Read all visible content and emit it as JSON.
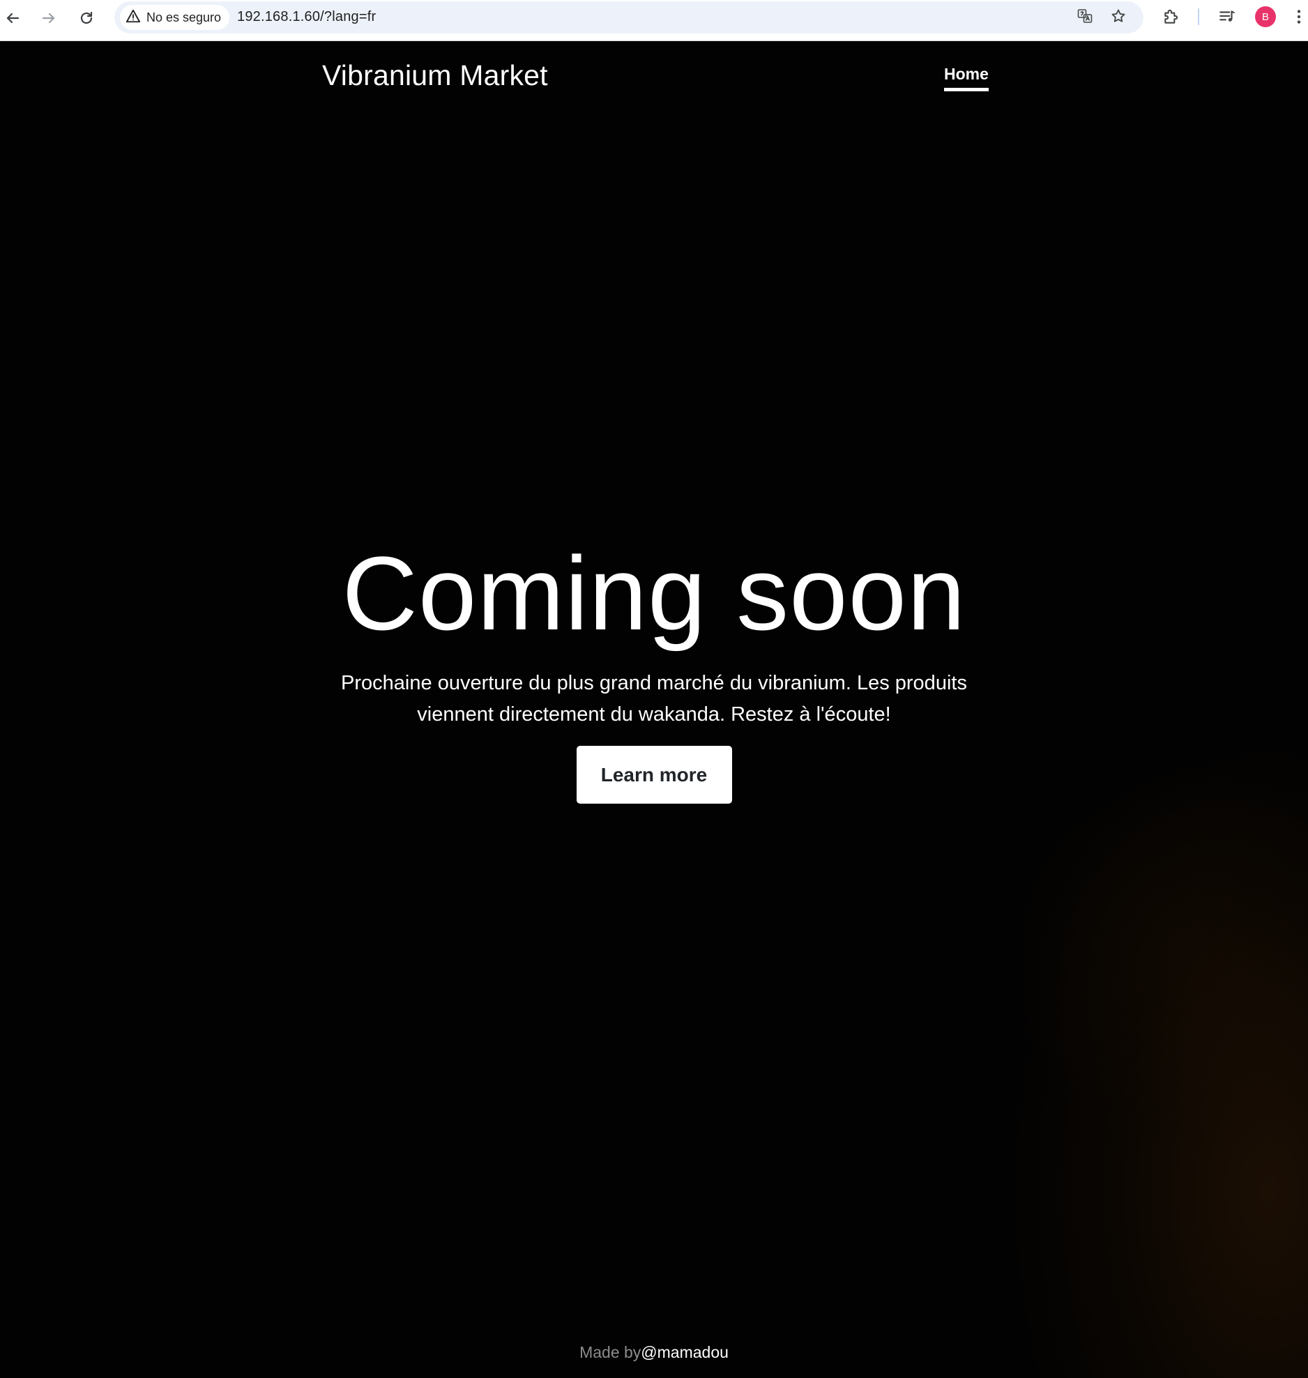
{
  "browser": {
    "security_label": "No es seguro",
    "url": "192.168.1.60/?lang=fr",
    "profile_initial": "B",
    "icons": {
      "back": "arrow-left-icon",
      "forward": "arrow-right-icon",
      "reload": "reload-icon",
      "security": "warning-triangle-icon",
      "translate": "translate-icon",
      "bookmark": "star-icon",
      "extensions": "puzzle-icon",
      "media": "media-queue-icon",
      "menu": "kebab-menu-icon"
    },
    "colors": {
      "avatar": "#e8336a",
      "omnibox_bg": "#edf2fa"
    }
  },
  "site": {
    "brand": "Vibranium Market",
    "nav": {
      "home_label": "Home"
    },
    "hero": {
      "title": "Coming soon",
      "lead": "Prochaine ouverture du plus grand marché du vibranium. Les produits viennent directement du wakanda. Restez à l'écoute!",
      "button_label": "Learn more"
    },
    "footer": {
      "prefix": "Made by",
      "handle": "@mamadou"
    },
    "colors": {
      "background": "#020202",
      "text": "#ffffff",
      "button_bg": "#ffffff",
      "button_text": "#212529",
      "footer_text": "#8c8c8c"
    }
  }
}
